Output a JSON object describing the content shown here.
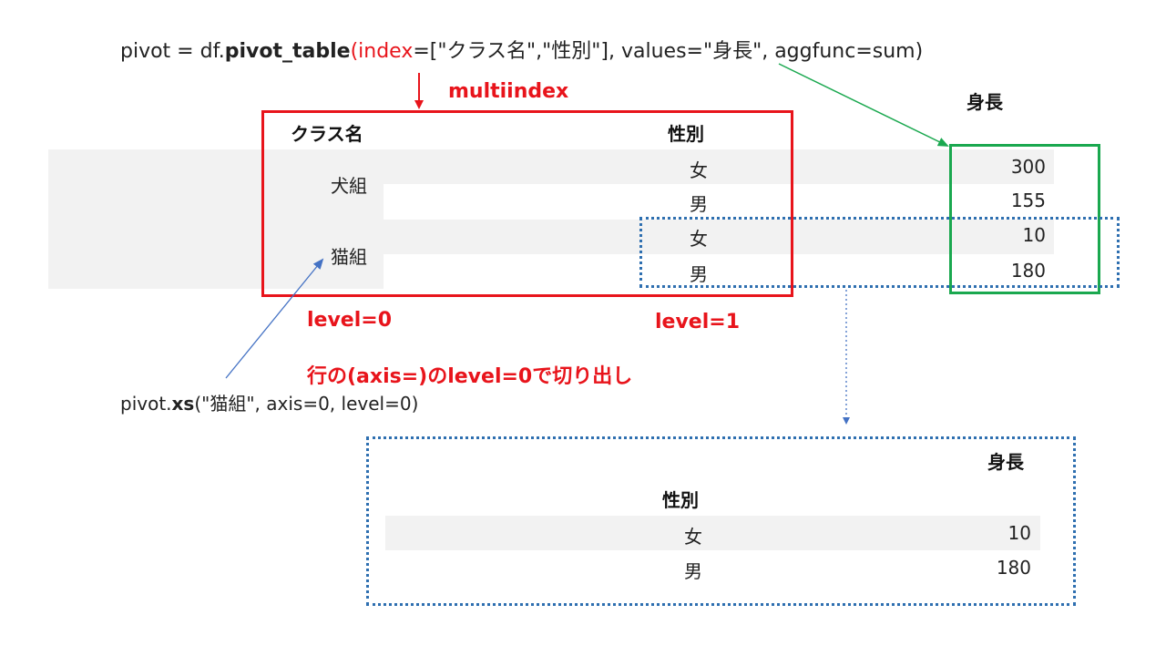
{
  "code_line": {
    "prefix": "pivot = df.",
    "func": "pivot_table",
    "open": "(",
    "index_kw": "index",
    "args": "=[\"クラス名\",\"性別\"], values=\"身長\", aggfunc=sum)"
  },
  "labels": {
    "multiindex": "multiindex",
    "level0": "level=0",
    "level1": "level=1",
    "slice_note": "行の(axis=)のlevel=0で切り出し"
  },
  "xs_code": {
    "prefix": "pivot.",
    "func": "xs",
    "args": "(\"猫組\", axis=0, level=0)"
  },
  "pivot_table": {
    "col_header_value": "身長",
    "index_header_0": "クラス名",
    "index_header_1": "性別",
    "groups": [
      {
        "name": "犬組",
        "rows": [
          {
            "sex": "女",
            "value": "300"
          },
          {
            "sex": "男",
            "value": "155"
          }
        ]
      },
      {
        "name": "猫組",
        "rows": [
          {
            "sex": "女",
            "value": "10"
          },
          {
            "sex": "男",
            "value": "180"
          }
        ]
      }
    ]
  },
  "result_table": {
    "col_header_value": "身長",
    "index_header": "性別",
    "rows": [
      {
        "sex": "女",
        "value": "10"
      },
      {
        "sex": "男",
        "value": "180"
      }
    ]
  },
  "colors": {
    "index_box": "#e8141b",
    "value_box": "#1aa84f",
    "slice_box": "#2e6fb0",
    "row_band": "#f2f2f2"
  }
}
